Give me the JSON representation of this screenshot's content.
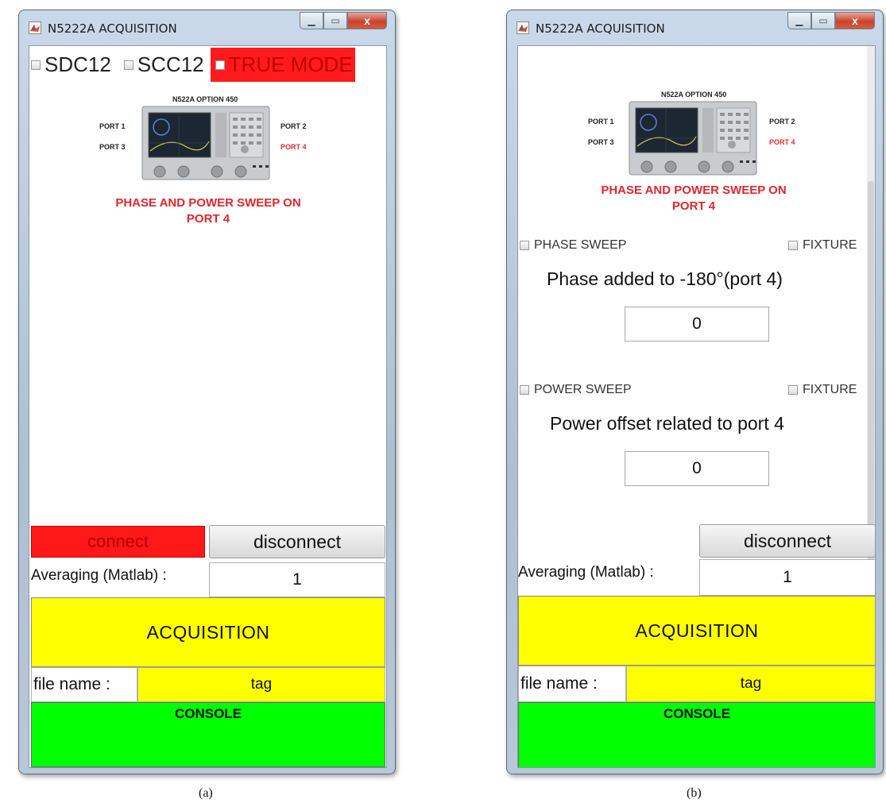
{
  "window_a": {
    "title": "N5222A ACQUISITION",
    "close_glyph": "x",
    "modes": {
      "sdc12": "SDC12",
      "scc12": "SCC12",
      "true_mode": "TRUE MODE"
    },
    "device": {
      "title": "N522A OPTION 450",
      "port1": "PORT 1",
      "port2": "PORT 2",
      "port3": "PORT 3",
      "port4": "PORT 4",
      "caption": "PHASE AND POWER SWEEP ON PORT 4"
    },
    "connect_label": "connect",
    "disconnect_label": "disconnect",
    "averaging_label": "Averaging (Matlab) :",
    "averaging_value": "1",
    "acquisition_label": "ACQUISITION",
    "file_name_label": "file name :",
    "file_name_value": "tag",
    "console_label": "CONSOLE"
  },
  "window_b": {
    "title": "N5222A ACQUISITION",
    "close_glyph": "x",
    "device": {
      "title": "N522A OPTION 450",
      "port1": "PORT 1",
      "port2": "PORT 2",
      "port3": "PORT 3",
      "port4": "PORT 4",
      "caption": "PHASE AND POWER SWEEP ON PORT 4"
    },
    "phase_sweep_label": "PHASE SWEEP",
    "phase_fixture_label": "FIXTURE",
    "phase_title": "Phase added to -180°(port 4)",
    "phase_value": "0",
    "power_sweep_label": "POWER SWEEP",
    "power_fixture_label": "FIXTURE",
    "power_title": "Power offset related to port 4",
    "power_value": "0",
    "disconnect_label": "disconnect",
    "averaging_label": "Averaging (Matlab) :",
    "averaging_value": "1",
    "acquisition_label": "ACQUISITION",
    "file_name_label": "file name :",
    "file_name_value": "tag",
    "console_label": "CONSOLE"
  },
  "captions": {
    "a": "(a)",
    "b": "(b)"
  },
  "colors": {
    "connect_red": "#ff1818",
    "true_mode_red": "#ff1b1b",
    "acquisition_yellow": "#ffff00",
    "console_green": "#00ff00",
    "caption_red": "#e0262e"
  }
}
